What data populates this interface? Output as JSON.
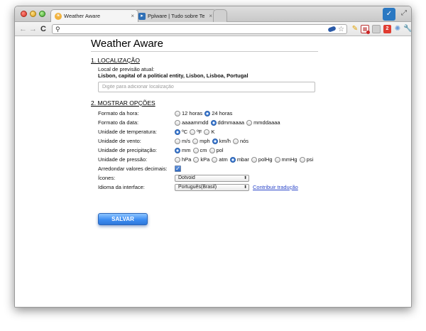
{
  "browser": {
    "tabs": [
      {
        "title": "Weather Aware",
        "close": "×",
        "active": true
      },
      {
        "title": "Pplware | Tudo sobre Tecnologia",
        "close": "×",
        "active": false
      }
    ],
    "omnibox": {
      "value": "",
      "placeholder": ""
    },
    "extensions": {
      "badge_count": "2"
    },
    "colors": {
      "accent": "#3d8df2",
      "link": "#2a45c9"
    }
  },
  "page": {
    "title": "Weather Aware",
    "section1": {
      "heading": "1. LOCALIZAÇÃO",
      "label": "Local de previsão atual:",
      "current": "Lisbon, capital of a political entity, Lisbon, Lisboa, Portugal",
      "input_placeholder": "Digite para adicionar localização"
    },
    "section2": {
      "heading": "2. MOSTRAR OPÇÕES",
      "hour_format": {
        "label": "Formato da hora:",
        "options": [
          "12 horas",
          "24 horas"
        ],
        "selected": "24 horas"
      },
      "date_format": {
        "label": "Formato da data:",
        "options": [
          "aaaammdd",
          "ddmmaaaa",
          "mmddaaaa"
        ],
        "selected": "ddmmaaaa"
      },
      "temperature_unit": {
        "label": "Unidade de temperatura:",
        "options": [
          "ºC",
          "ºF",
          "K"
        ],
        "selected": "ºC"
      },
      "wind_unit": {
        "label": "Unidade de vento:",
        "options": [
          "m/s",
          "mph",
          "km/h",
          "nós"
        ],
        "selected": "km/h"
      },
      "precipitation_unit": {
        "label": "Unidade de precipitação:",
        "options": [
          "mm",
          "cm",
          "pol"
        ],
        "selected": "mm"
      },
      "pressure_unit": {
        "label": "Unidade de pressão:",
        "options": [
          "hPa",
          "kPa",
          "atm",
          "mbar",
          "polHg",
          "mmHg",
          "psi"
        ],
        "selected": "mbar"
      },
      "round_values": {
        "label": "Arredondar valores decimais:",
        "checked": true
      },
      "icons": {
        "label": "Ícones:",
        "value": "Dotvoid"
      },
      "language": {
        "label": "Idioma da interface:",
        "value": "Português(Brasil)",
        "link": "Contribuir tradução"
      }
    },
    "save_label": "SALVAR"
  }
}
